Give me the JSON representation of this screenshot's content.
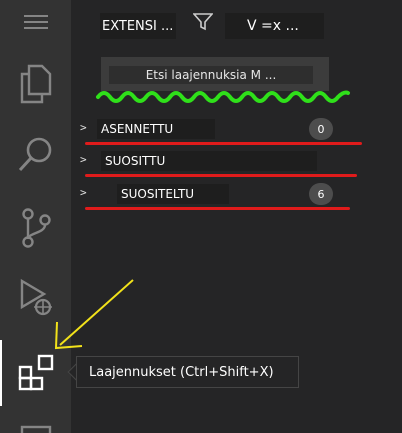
{
  "activity_bar": {
    "items": [
      {
        "name": "menu",
        "icon": "menu-icon"
      },
      {
        "name": "explorer",
        "icon": "files-icon"
      },
      {
        "name": "search",
        "icon": "search-icon"
      },
      {
        "name": "source-control",
        "icon": "source-control-icon"
      },
      {
        "name": "run-debug",
        "icon": "run-debug-icon"
      },
      {
        "name": "extensions",
        "icon": "extensions-icon",
        "active": true
      },
      {
        "name": "remote",
        "icon": "remote-explorer-icon"
      }
    ]
  },
  "sidebar": {
    "title": "EXTENSI ...",
    "filter_icon": "filter-icon",
    "views_label": "V =x ...",
    "search": {
      "placeholder": "Etsi laajennuksia M ..."
    },
    "sections": [
      {
        "label": "ASENNETTU",
        "chevron": ">",
        "count": "0"
      },
      {
        "label": "SUOSITTU",
        "chevron": ">",
        "count": ""
      },
      {
        "label": "SUOSITELTU",
        "chevron": ">",
        "count": "6"
      }
    ]
  },
  "tooltip": {
    "text": "Laajennukset (Ctrl+Shift+X)"
  },
  "annotations": {
    "squiggle_color": "#2fe01a",
    "underline_color": "#e01b1b",
    "arrow_color": "#f2e21a"
  },
  "colors": {
    "activity_bar_bg": "#333333",
    "sidebar_bg": "#252526",
    "active_indicator": "#ffffff"
  }
}
